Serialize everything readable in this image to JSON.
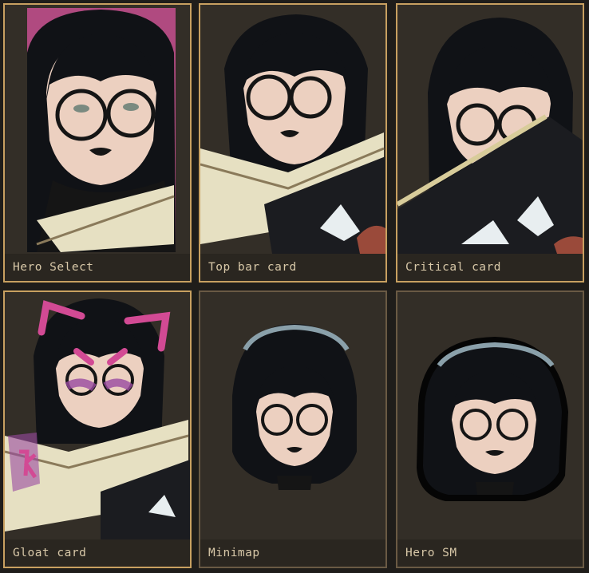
{
  "cards": [
    {
      "label": "Hero Select",
      "highlighted": true,
      "variant": "hero-select"
    },
    {
      "label": "Top bar card",
      "highlighted": true,
      "variant": "top-bar"
    },
    {
      "label": "Critical card",
      "highlighted": true,
      "variant": "critical"
    },
    {
      "label": "Gloat card",
      "highlighted": true,
      "variant": "gloat"
    },
    {
      "label": "Minimap",
      "highlighted": false,
      "variant": "minimap"
    },
    {
      "label": "Hero SM",
      "highlighted": false,
      "variant": "hero-sm"
    }
  ],
  "colors": {
    "frame_highlight": "#c8a060",
    "frame_dim": "#6a5a44",
    "card_bg": "#332e27",
    "page_bg": "#1f1d1a",
    "hair": "#0f1114",
    "skin": "#f0d2c2",
    "accent_pink": "#d24a94",
    "book_cream": "#e8e0c0"
  }
}
